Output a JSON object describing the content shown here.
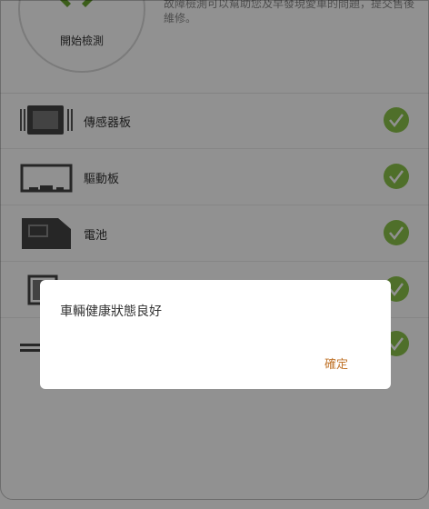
{
  "header": {
    "start_label": "開始檢測",
    "description": "故障檢測可以幫助您及早發現愛車的問題，提交售後維修。"
  },
  "components": [
    {
      "label": "傳感器板",
      "icon": "sensor-board-icon",
      "status": "ok"
    },
    {
      "label": "驅動板",
      "icon": "driver-board-icon",
      "status": "ok"
    },
    {
      "label": "電池",
      "icon": "battery-icon",
      "status": "ok"
    },
    {
      "label": "",
      "icon": "motor-icon",
      "status": "ok"
    },
    {
      "label": "",
      "icon": "cable-icon",
      "status": "ok"
    }
  ],
  "dialog": {
    "message": "車輛健康狀態良好",
    "ok_label": "確定"
  },
  "colors": {
    "check": "#8bc34a",
    "accent": "#c0742b",
    "overlay": "rgba(0,0,0,0.43)"
  }
}
